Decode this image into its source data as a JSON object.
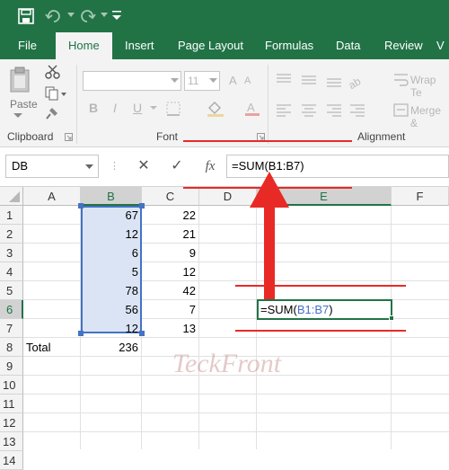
{
  "ribbon": {
    "tabs": [
      "File",
      "Home",
      "Insert",
      "Page Layout",
      "Formulas",
      "Data",
      "Review"
    ],
    "font_size": "11",
    "wrap_text": "Wrap Te",
    "merge": "Merge &",
    "paste": "Paste",
    "groups": {
      "clipboard": "Clipboard",
      "font": "Font",
      "alignment": "Alignment"
    }
  },
  "formula_bar": {
    "name_box": "DB",
    "cancel": "✕",
    "enter": "✓",
    "fx": "fx",
    "formula": "=SUM(B1:B7)"
  },
  "columns": [
    "A",
    "B",
    "C",
    "D",
    "E",
    "F"
  ],
  "rows": [
    "1",
    "2",
    "3",
    "4",
    "5",
    "6",
    "7",
    "8",
    "9",
    "10",
    "11",
    "12",
    "13",
    "14"
  ],
  "cells": {
    "B": [
      "67",
      "12",
      "6",
      "5",
      "78",
      "56",
      "12",
      "236"
    ],
    "C": [
      "22",
      "21",
      "9",
      "12",
      "42",
      "7",
      "13"
    ],
    "A8": "Total"
  },
  "edit_cell": {
    "prefix": "=SUM(",
    "range": "B1:B7",
    "suffix": ")"
  },
  "watermark": "TeckFront",
  "colors": {
    "accent": "#217346",
    "range": "#4472c4",
    "annotation": "#e82a27"
  }
}
